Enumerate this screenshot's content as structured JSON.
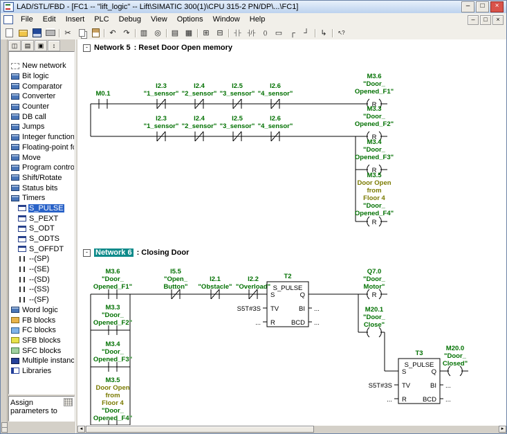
{
  "window": {
    "title": "LAD/STL/FBD - [FC1 -- \"lift_logic\" -- Lift\\SIMATIC 300(1)\\CPU 315-2 PN/DP\\...\\FC1]",
    "minimize": "–",
    "maximize": "□",
    "close": "×"
  },
  "menu": {
    "items": [
      {
        "label": "File"
      },
      {
        "label": "Edit"
      },
      {
        "label": "Insert"
      },
      {
        "label": "PLC"
      },
      {
        "label": "Debug"
      },
      {
        "label": "View"
      },
      {
        "label": "Options"
      },
      {
        "label": "Window"
      },
      {
        "label": "Help"
      }
    ],
    "minimize": "–",
    "restore": "□",
    "close": "×"
  },
  "toolbar": {
    "buttons": [
      {
        "icon": "new-file-icon",
        "glyph": ""
      },
      {
        "icon": "open-folder-icon",
        "glyph": ""
      },
      {
        "icon": "save-icon",
        "glyph": ""
      },
      {
        "icon": "print-icon",
        "glyph": ""
      },
      {
        "icon": "toolbar-separator",
        "glyph": "",
        "cls": "sep"
      },
      {
        "icon": "cut-icon",
        "glyph": "✂"
      },
      {
        "icon": "copy-icon",
        "glyph": ""
      },
      {
        "icon": "paste-icon",
        "glyph": ""
      },
      {
        "icon": "toolbar-separator",
        "glyph": "",
        "cls": "sep"
      },
      {
        "icon": "undo-icon",
        "glyph": "↶"
      },
      {
        "icon": "redo-icon",
        "glyph": "↷"
      },
      {
        "icon": "toolbar-separator",
        "glyph": "",
        "cls": "sep"
      },
      {
        "icon": "view-grid-icon",
        "glyph": "▥"
      },
      {
        "icon": "monitor-icon",
        "glyph": "◎"
      },
      {
        "icon": "toolbar-separator",
        "glyph": "",
        "cls": "sep"
      },
      {
        "icon": "symbol-display-icon",
        "glyph": "▤"
      },
      {
        "icon": "symbol-info-icon",
        "glyph": "▦"
      },
      {
        "icon": "toolbar-separator",
        "glyph": "",
        "cls": "sep"
      },
      {
        "icon": "insert-network-icon",
        "glyph": "⊞"
      },
      {
        "icon": "program-elements-icon",
        "glyph": "⊟"
      },
      {
        "icon": "toolbar-separator",
        "glyph": "",
        "cls": "sep"
      },
      {
        "icon": "contact-no-icon",
        "glyph": "┤├",
        "cls": "tiny"
      },
      {
        "icon": "contact-nc-icon",
        "glyph": "┤/├",
        "cls": "tiny"
      },
      {
        "icon": "coil-icon",
        "glyph": "( )",
        "cls": "tiny"
      },
      {
        "icon": "empty-box-icon",
        "glyph": "▭"
      },
      {
        "icon": "open-branch-icon",
        "glyph": "┌"
      },
      {
        "icon": "close-branch-icon",
        "glyph": "┘"
      },
      {
        "icon": "toolbar-separator",
        "glyph": "",
        "cls": "sep"
      },
      {
        "icon": "insert-connector-icon",
        "glyph": "↳"
      },
      {
        "icon": "toolbar-separator",
        "glyph": "",
        "cls": "sep"
      },
      {
        "icon": "help-pointer-icon",
        "glyph": "↖?",
        "cls": "tiny"
      }
    ]
  },
  "sidebar": {
    "toolbar": [
      {
        "icon": "pane-overview-icon",
        "glyph": "◫"
      },
      {
        "icon": "pane-list-icon",
        "glyph": "▤"
      },
      {
        "icon": "pane-detail-icon",
        "glyph": "▣"
      },
      {
        "icon": "pane-split-icon",
        "glyph": "↕"
      }
    ],
    "items": [
      {
        "label": "New network",
        "icon": "new-network-icon"
      },
      {
        "label": "Bit logic",
        "icon": "category-icon"
      },
      {
        "label": "Comparator",
        "icon": "category-icon"
      },
      {
        "label": "Converter",
        "icon": "category-icon"
      },
      {
        "label": "Counter",
        "icon": "category-icon"
      },
      {
        "label": "DB call",
        "icon": "category-icon"
      },
      {
        "label": "Jumps",
        "icon": "category-icon"
      },
      {
        "label": "Integer function",
        "icon": "category-icon"
      },
      {
        "label": "Floating-point fct.",
        "icon": "category-icon"
      },
      {
        "label": "Move",
        "icon": "category-icon"
      },
      {
        "label": "Program control",
        "icon": "category-icon"
      },
      {
        "label": "Shift/Rotate",
        "icon": "category-icon"
      },
      {
        "label": "Status bits",
        "icon": "category-icon"
      },
      {
        "label": "Timers",
        "icon": "category-icon"
      },
      {
        "label": "S_PULSE",
        "icon": "timer-block-icon",
        "cls": "child selected"
      },
      {
        "label": "S_PEXT",
        "icon": "timer-block-icon",
        "cls": "child"
      },
      {
        "label": "S_ODT",
        "icon": "timer-block-icon",
        "cls": "child"
      },
      {
        "label": "S_ODTS",
        "icon": "timer-block-icon",
        "cls": "child"
      },
      {
        "label": "S_OFFDT",
        "icon": "timer-block-icon",
        "cls": "child"
      },
      {
        "label": "--(SP)",
        "icon": "coil-element-icon",
        "cls": "child"
      },
      {
        "label": "--(SE)",
        "icon": "coil-element-icon",
        "cls": "child"
      },
      {
        "label": "--(SD)",
        "icon": "coil-element-icon",
        "cls": "child"
      },
      {
        "label": "--(SS)",
        "icon": "coil-element-icon",
        "cls": "child"
      },
      {
        "label": "--(SF)",
        "icon": "coil-element-icon",
        "cls": "child"
      },
      {
        "label": "Word logic",
        "icon": "category-icon"
      },
      {
        "label": "FB blocks",
        "icon": "fb-folder-icon"
      },
      {
        "label": "FC blocks",
        "icon": "fc-folder-icon"
      },
      {
        "label": "SFB blocks",
        "icon": "sfb-folder-icon"
      },
      {
        "label": "SFC blocks",
        "icon": "sfc-folder-icon"
      },
      {
        "label": "Multiple instances",
        "icon": "multi-instance-icon"
      },
      {
        "label": "Libraries",
        "icon": "library-icon"
      }
    ],
    "description": [
      "Assign",
      "parameters to"
    ]
  },
  "scrollbar": {
    "left": "◄",
    "right": "►"
  },
  "n5": {
    "collapse": "-",
    "title": "Network 5",
    "comment": ": Reset Door Open memory",
    "r1c0": "M0.1",
    "r1": [
      {
        "a": "I2.3",
        "s": "\"1_sensor\""
      },
      {
        "a": "I2.4",
        "s": "\"2_sensor\""
      },
      {
        "a": "I2.5",
        "s": "\"3_sensor\""
      },
      {
        "a": "I2.6",
        "s": "\"4_sensor\""
      }
    ],
    "r2": [
      {
        "a": "I2.3",
        "s": "\"1_sensor\""
      },
      {
        "a": "I2.4",
        "s": "\"2_sensor\""
      },
      {
        "a": "I2.5",
        "s": "\"3_sensor\""
      },
      {
        "a": "I2.6",
        "s": "\"4_sensor\""
      }
    ],
    "c1": {
      "a": "M3.6",
      "s1": "\"Door_",
      "s2": "Opened_F1\"",
      "t": "R"
    },
    "c2": {
      "a": "M3.3",
      "s1": "\"Door_",
      "s2": "Opened_F2\"",
      "t": "R"
    },
    "c3": {
      "a": "M3.4",
      "s1": "\"Door_",
      "s2": "Opened_F3\"",
      "t": "R"
    },
    "c4": {
      "a": "M3.5",
      "cm1": "Door Open",
      "cm2": "from",
      "cm3": "Floor 4",
      "s1": "\"Door_",
      "s2": "Opened_F4\"",
      "t": "R"
    }
  },
  "n6": {
    "collapse": "-",
    "title": "Network 6",
    "comment": ": Closing Door",
    "p": [
      {
        "a": "M3.6",
        "s1": "\"Door_",
        "s2": "Opened_F1\""
      },
      {
        "a": "M3.3",
        "s1": "\"Door_",
        "s2": "Opened_F2\""
      },
      {
        "a": "M3.4",
        "s1": "\"Door_",
        "s2": "Opened_F3\""
      },
      {
        "a": "M3.5",
        "cm1": "Door Open",
        "cm2": "from",
        "cm3": "Floor 4",
        "s1": "\"Door_",
        "s2": "Opened_F4\""
      }
    ],
    "s": [
      {
        "a": "I5.5",
        "s1": "\"Open_",
        "s2": "Button\""
      },
      {
        "a": "I2.1",
        "s1": "\"Obstacle\""
      },
      {
        "a": "I2.2",
        "s1": "\"Overload\""
      }
    ],
    "t2": {
      "name": "T2",
      "type": "S_PULSE",
      "pin_s": "S",
      "pin_tv": "TV",
      "pin_r": "R",
      "pin_q": "Q",
      "pin_bi": "BI",
      "pin_bcd": "BCD",
      "tv_val": "S5T#3S",
      "r_val": "...",
      "bi_val": "...",
      "bcd_val": "..."
    },
    "t3": {
      "name": "T3",
      "type": "S_PULSE",
      "pin_s": "S",
      "pin_tv": "TV",
      "pin_r": "R",
      "pin_q": "Q",
      "pin_bi": "BI",
      "pin_bcd": "BCD",
      "tv_val": "S5T#3S",
      "r_val": "...",
      "bi_val": "...",
      "bcd_val": "..."
    },
    "cq": {
      "a": "Q7.0",
      "s1": "\"Door_",
      "s2": "Motor\"",
      "t": "R"
    },
    "cm1": {
      "a": "M20.1",
      "s1": "\"Door_",
      "s2": "Close\""
    },
    "cm0": {
      "a": "M20.0",
      "s1": "\"Door_",
      "s2": "Closed\""
    }
  }
}
